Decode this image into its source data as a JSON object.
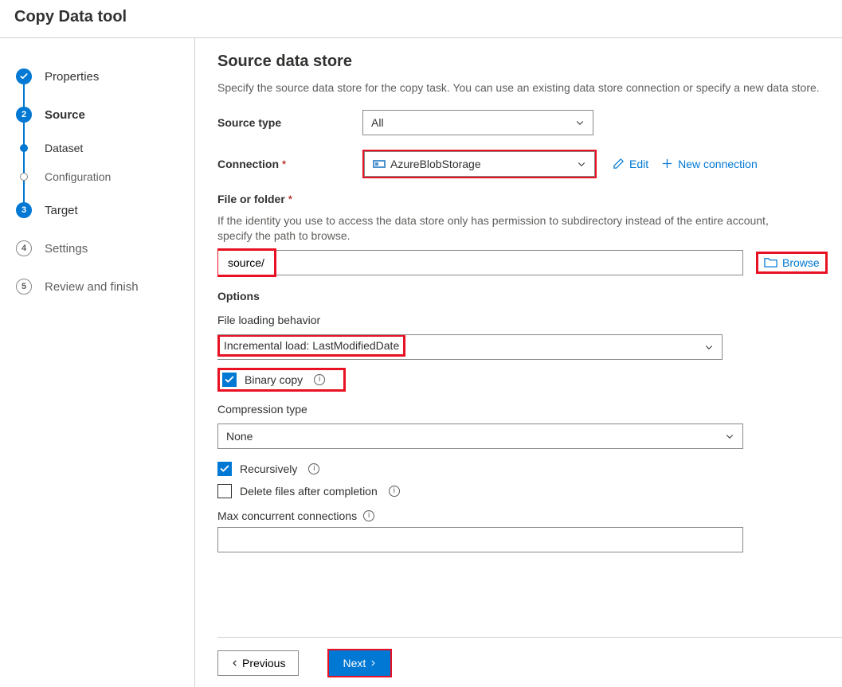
{
  "page_title": "Copy Data tool",
  "wizard": {
    "steps": [
      {
        "label": "Properties",
        "state": "done"
      },
      {
        "label": "Source",
        "state": "current",
        "substeps": [
          {
            "label": "Dataset",
            "state": "active"
          },
          {
            "label": "Configuration",
            "state": "inactive"
          }
        ]
      },
      {
        "label": "Target",
        "state": "upcoming-blue",
        "num": "3"
      },
      {
        "label": "Settings",
        "state": "future",
        "num": "4"
      },
      {
        "label": "Review and finish",
        "state": "future",
        "num": "5"
      }
    ]
  },
  "main": {
    "heading": "Source data store",
    "description": "Specify the source data store for the copy task. You can use an existing data store connection or specify a new data store.",
    "source_type_label": "Source type",
    "source_type_value": "All",
    "connection_label": "Connection",
    "connection_value": "AzureBlobStorage",
    "edit_label": "Edit",
    "new_conn_label": "New connection",
    "file_folder_label": "File or folder",
    "file_folder_hint": "If the identity you use to access the data store only has permission to subdirectory instead of the entire account, specify the path to browse.",
    "file_folder_value": "source/",
    "browse_label": "Browse",
    "options_label": "Options",
    "file_loading_label": "File loading behavior",
    "file_loading_value": "Incremental load: LastModifiedDate",
    "binary_copy_label": "Binary copy",
    "compression_label": "Compression type",
    "compression_value": "None",
    "recursively_label": "Recursively",
    "delete_after_label": "Delete files after completion",
    "max_conn_label": "Max concurrent connections",
    "prev_label": "Previous",
    "next_label": "Next"
  }
}
